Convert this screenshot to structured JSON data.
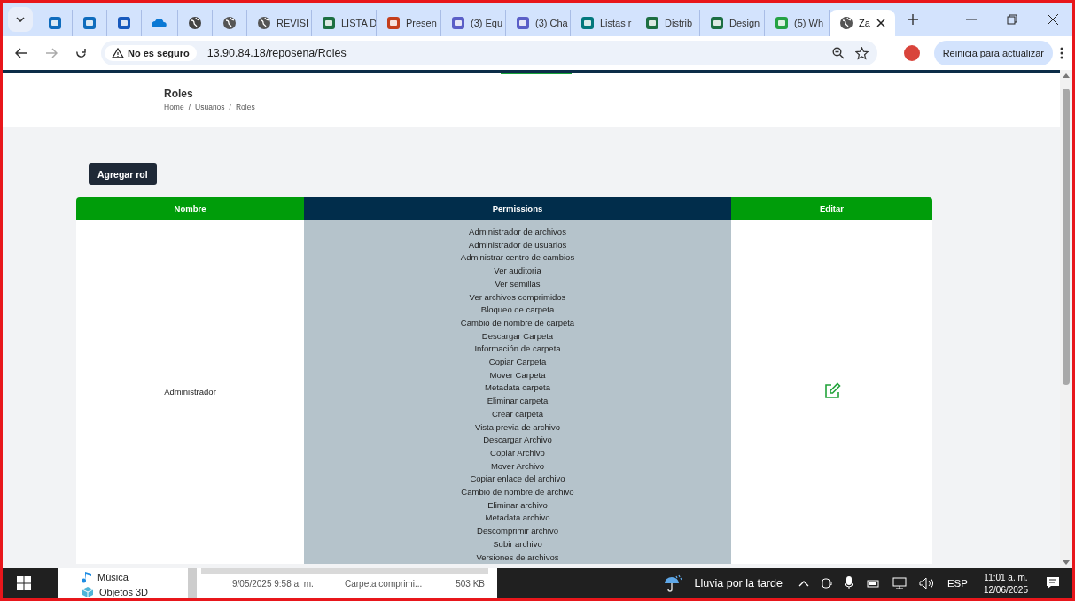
{
  "browser": {
    "tabs": [
      {
        "kind": "outlook",
        "selected": false
      },
      {
        "kind": "outlook",
        "selected": false
      },
      {
        "kind": "doc",
        "selected": false
      },
      {
        "kind": "cloud",
        "selected": false
      },
      {
        "kind": "g",
        "selected": false
      },
      {
        "kind": "globe",
        "selected": false
      },
      {
        "kind": "globe",
        "title": "REVISI",
        "selected": false
      },
      {
        "kind": "excel",
        "title": "LISTA D",
        "selected": false
      },
      {
        "kind": "slides",
        "title": "Presen",
        "selected": false
      },
      {
        "kind": "teams",
        "title": "(3) Equ",
        "selected": false
      },
      {
        "kind": "teams",
        "title": "(3) Cha",
        "selected": false
      },
      {
        "kind": "sharepoint",
        "title": "Listas r",
        "selected": false
      },
      {
        "kind": "excel",
        "title": "Distrib",
        "selected": false
      },
      {
        "kind": "excel",
        "title": "Design",
        "selected": false
      },
      {
        "kind": "chat",
        "title": "(5) Wh",
        "selected": false
      },
      {
        "kind": "globe",
        "title": "Za",
        "selected": true
      }
    ],
    "address_bar": {
      "security": "No es seguro",
      "url": "13.90.84.18/reposena/Roles"
    },
    "update_button": "Reinicia para actualizar"
  },
  "page": {
    "title": "Roles",
    "breadcrumb": {
      "separator": "/",
      "items": [
        "Home",
        "Usuarios",
        "Roles"
      ]
    },
    "add_button": "Agregar rol",
    "table": {
      "columns": [
        "Nombre",
        "Permissions",
        "Editar"
      ],
      "rows": [
        {
          "name": "Administrador",
          "permissions": [
            "Administrador de archivos",
            "Administrador de usuarios",
            "Administrar centro de cambios",
            "Ver auditoria",
            "Ver semillas",
            "Ver archivos comprimidos",
            "Bloqueo de carpeta",
            "Cambio de nombre de carpeta",
            "Descargar Carpeta",
            "Información de carpeta",
            "Copiar Carpeta",
            "Mover Carpeta",
            "Metadata carpeta",
            "Eliminar carpeta",
            "Crear carpeta",
            "Vista previa de archivo",
            "Descargar Archivo",
            "Copiar Archivo",
            "Mover Archivo",
            "Copiar enlace del archivo",
            "Cambio de nombre de archivo",
            "Eliminar archivo",
            "Metadata archivo",
            "Descomprimir archivo",
            "Subir archivo",
            "Versiones de archivos"
          ]
        }
      ]
    }
  },
  "explorer_fragment": {
    "nav_items": [
      {
        "kind": "music",
        "label": "Música"
      },
      {
        "kind": "cube",
        "label": "Objetos 3D"
      }
    ],
    "file_row": {
      "date": "9/05/2025 9:58 a. m.",
      "type": "Carpeta comprimi...",
      "size": "503 KB"
    }
  },
  "taskbar": {
    "weather": "Lluvia por la tarde",
    "language": "ESP",
    "time": "11:01 a. m.",
    "date": "12/06/2025"
  }
}
